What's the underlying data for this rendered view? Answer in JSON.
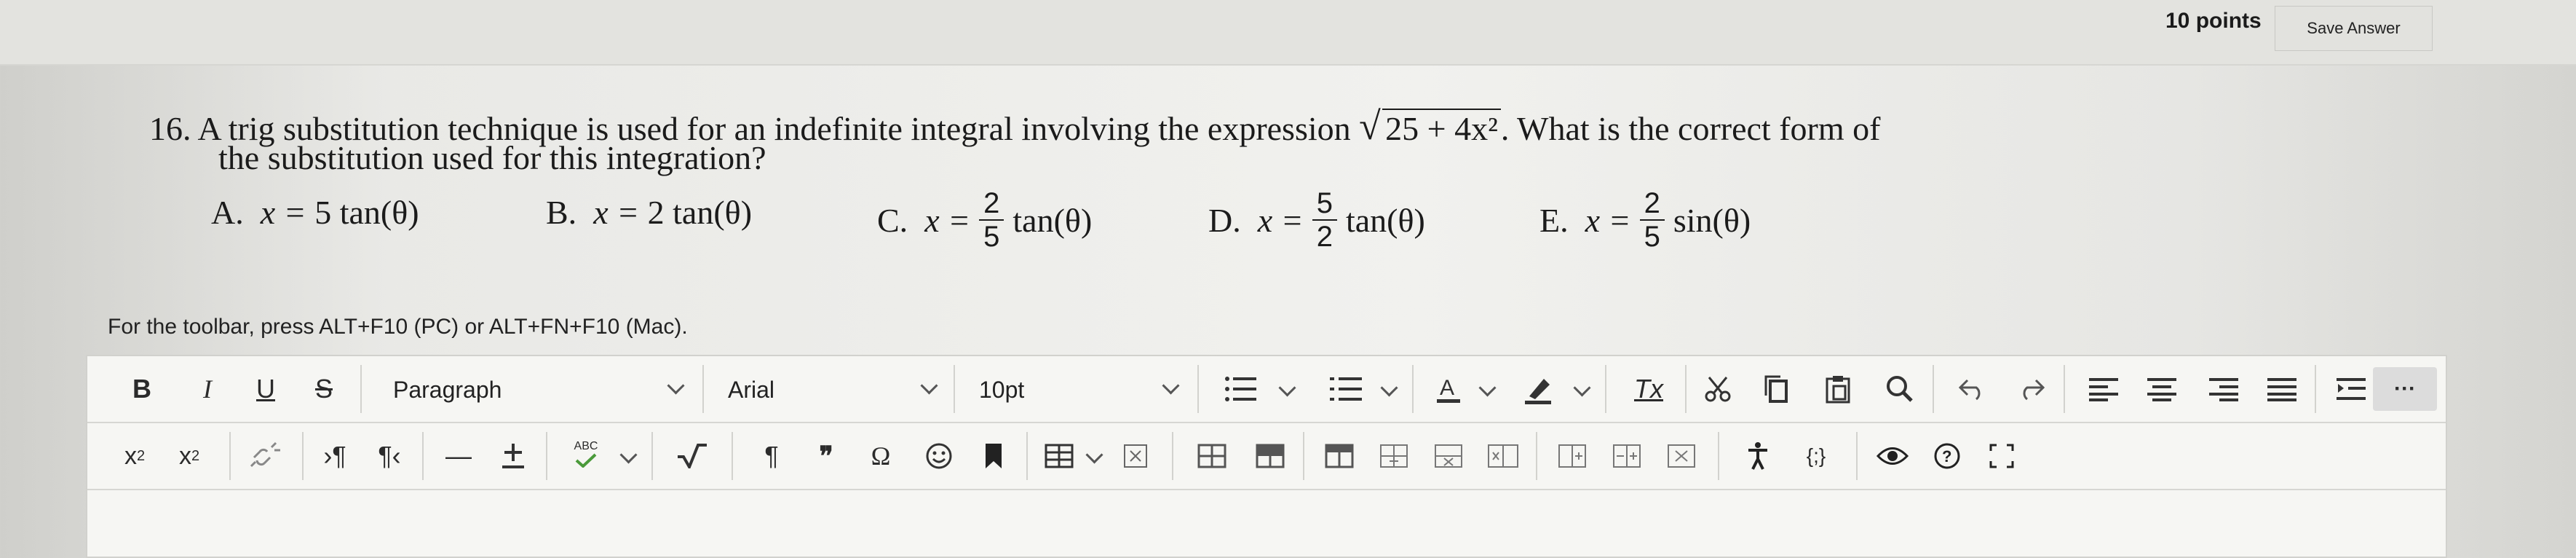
{
  "header": {
    "points": "10 points",
    "save_label": "Save Answer"
  },
  "question": {
    "number": "16.",
    "text_before": "A trig substitution technique is used for an indefinite integral involving the expression",
    "expression": "25 + 4x²",
    "text_after": ". What is the correct form of",
    "line2": "the substitution used for this integration?"
  },
  "answers": [
    {
      "label": "A.",
      "lhs": "x =",
      "coef": "5",
      "func": "tan(θ)"
    },
    {
      "label": "B.",
      "lhs": "x =",
      "coef": "2",
      "func": "tan(θ)"
    },
    {
      "label": "C.",
      "lhs": "x =",
      "num": "2",
      "den": "5",
      "func": "tan(θ)"
    },
    {
      "label": "D.",
      "lhs": "x =",
      "num": "5",
      "den": "2",
      "func": "tan(θ)"
    },
    {
      "label": "E.",
      "lhs": "x =",
      "num": "2",
      "den": "5",
      "func": "sin(θ)"
    }
  ],
  "editor": {
    "toolbar_hint": "For the toolbar, press ALT+F10 (PC) or ALT+FN+F10 (Mac).",
    "bold": "B",
    "italic": "I",
    "underline": "U",
    "strike": "S",
    "paragraph": "Paragraph",
    "font": "Arial",
    "size": "10pt",
    "more": "···",
    "pilcrow_ltr": "›¶",
    "pilcrow_rtl": "¶‹",
    "hr": "—",
    "pilcrow": "¶",
    "quote": "❞",
    "omega": "Ω",
    "clear_format": "Tx",
    "html": "{;}",
    "spell": "ABC"
  },
  "colors": {
    "text": "#1b1b1b",
    "toolbar_bg": "#f6f6f3",
    "border": "#d1d1cd"
  }
}
